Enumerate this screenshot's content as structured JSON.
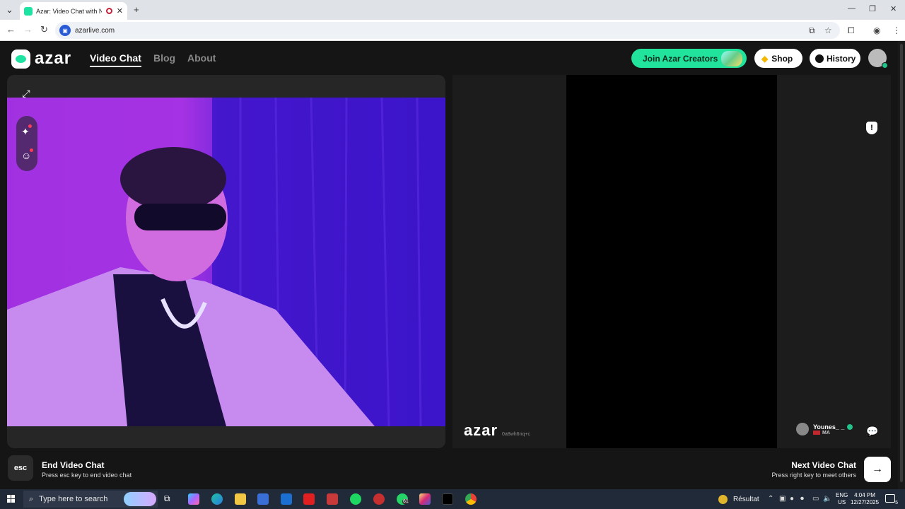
{
  "browser": {
    "tab_title": "Azar: Video Chat with New",
    "url": "azarlive.com"
  },
  "site": {
    "logo_text": "azar",
    "nav": [
      {
        "label": "Video Chat",
        "active": true
      },
      {
        "label": "Blog",
        "active": false
      },
      {
        "label": "About",
        "active": false
      }
    ],
    "join_creators_label": "Join Azar Creators",
    "shop_label": "Shop",
    "history_label": "History"
  },
  "remote": {
    "watermark": "azar",
    "session_id": "0a8wh6nq+c",
    "peer_name": "Younes_ _",
    "peer_country": "MA"
  },
  "controls": {
    "esc_label": "esc",
    "end_title": "End Video Chat",
    "end_sub": "Press esc key to end video chat",
    "next_title": "Next Video Chat",
    "next_sub": "Press right key to meet others",
    "next_icon": "→"
  },
  "taskbar": {
    "search_placeholder": "Type here to search",
    "whatsapp_count": "61",
    "weather_label": "Résultat",
    "lang_line1": "ENG",
    "lang_line2": "US",
    "time": "4:04 PM",
    "date": "12/27/2025",
    "notif_count": "5"
  },
  "colors": {
    "brand_green": "#22e39b",
    "bg_dark": "#151515"
  }
}
